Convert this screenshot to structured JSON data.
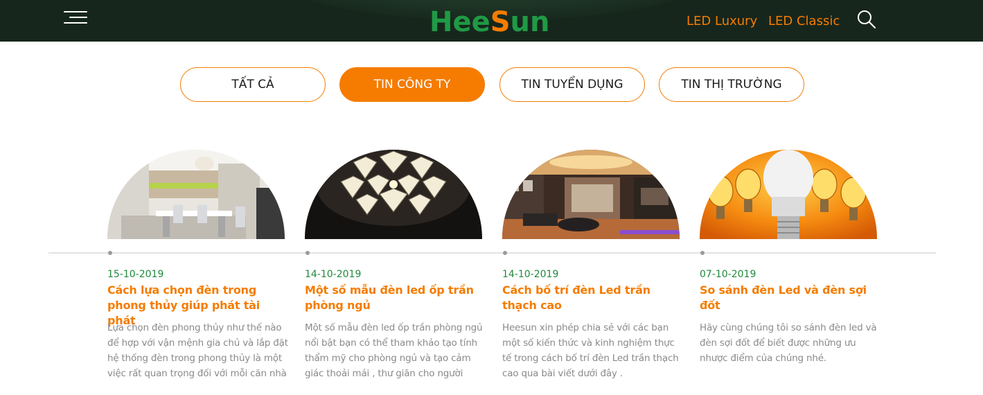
{
  "header": {
    "logo": {
      "part1": "Hee",
      "part2": "S",
      "part3": "un"
    },
    "nav": [
      {
        "label": "LED Luxury"
      },
      {
        "label": "LED Classic"
      }
    ],
    "icons": {
      "menu": "hamburger-icon",
      "search": "search-icon"
    }
  },
  "tabs": [
    {
      "label": "TẤT CẢ",
      "active": false
    },
    {
      "label": "TIN CÔNG TY",
      "active": true
    },
    {
      "label": "TIN TUYỂN DỤNG",
      "active": false
    },
    {
      "label": "TIN THỊ TRƯỜNG",
      "active": false
    }
  ],
  "posts": [
    {
      "date": "15-10-2019",
      "title": "Cách lựa chọn đèn trong phong thủy giúp phát tài phát",
      "excerpt": "Lựa chọn đèn phong thủy như thế nào để hợp với vận mệnh gia chủ và lắp đặt hệ thống đèn trong phong thủy là một việc rất quan trọng đối với mỗi căn nhà"
    },
    {
      "date": "14-10-2019",
      "title": "Một số mẫu đèn led ốp trần phòng ngủ",
      "excerpt": "Một số mẫu đèn led ốp trần phòng ngủ nổi bật bạn có thể tham khảo tạo tính thẩm mỹ cho phòng ngủ và tạo cảm giác thoải mái , thư giãn cho người"
    },
    {
      "date": "14-10-2019",
      "title": "Cách bố trí đèn Led trần thạch cao",
      "excerpt": "Heesun xin phép chia sẻ với các bạn một số kiến thức và kinh nghiệm thực tế trong cách bố trí đèn Led trần thạch cao qua bài viết dưới đây ."
    },
    {
      "date": "07-10-2019",
      "title": "So sánh đèn Led và đèn sợi đốt",
      "excerpt": "Hãy cùng chúng tôi so sánh đèn led và đèn sợi đốt để biết được những ưu nhược điểm của chúng nhé."
    }
  ],
  "colors": {
    "accent": "#f57c00",
    "brand_green": "#1f9a45",
    "header_bg": "#17261c"
  }
}
